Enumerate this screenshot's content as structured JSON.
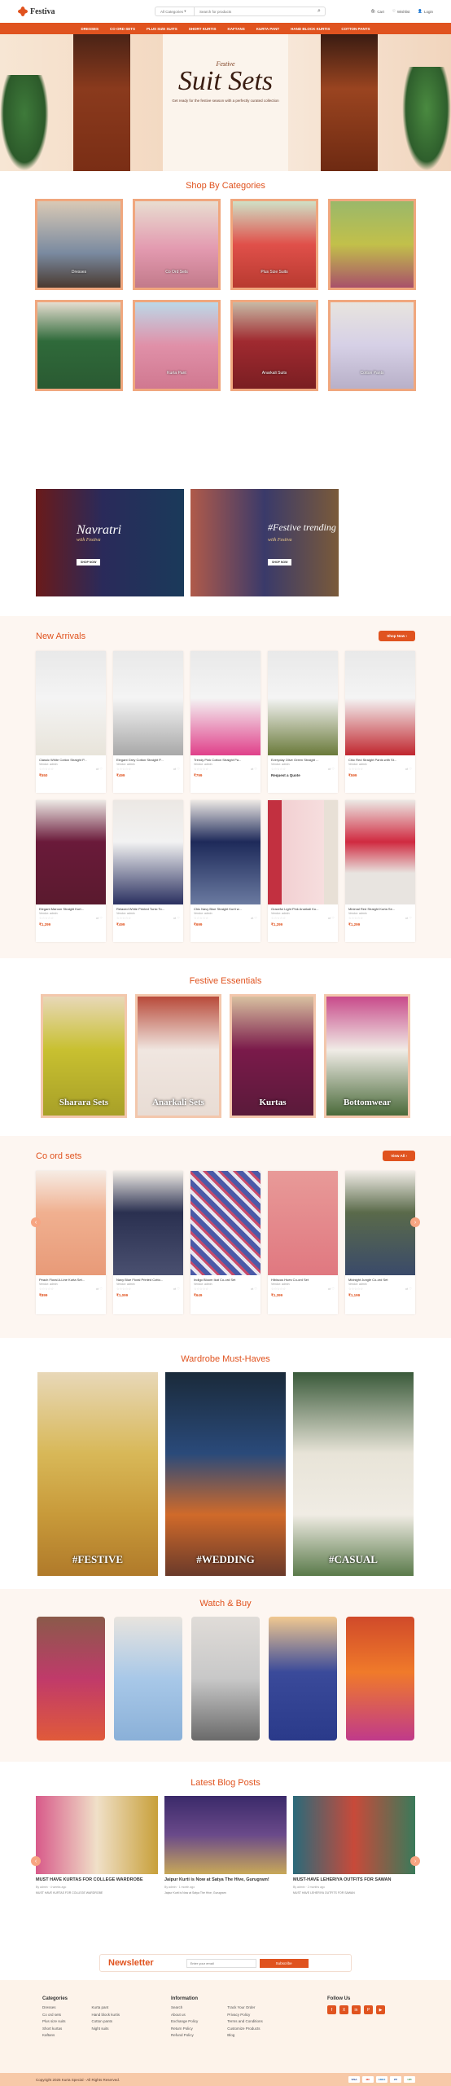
{
  "header": {
    "brand": "Festiva",
    "search_category": "All Categories",
    "search_placeholder": "Search for products",
    "cart_label": "Cart",
    "wishlist_label": "Wishlist",
    "login_label": "Login"
  },
  "nav": [
    "DRESSES",
    "CO ORD SETS",
    "PLUS SIZE SUITS",
    "SHORT KURTIS",
    "KAFTANS",
    "KURTA PANT",
    "HAND BLOCK KURTIS",
    "COTTON PANTS"
  ],
  "hero": {
    "small": "Festive",
    "title": "Suit Sets",
    "subtitle": "Get ready for the festive season with a perfectly curated collection"
  },
  "categories": {
    "title": "Shop By Categories",
    "items": [
      "Dresses",
      "Co Ord Sets",
      "Plus Size Suits",
      "",
      "",
      "Kurta Pant",
      "Anarkali Suits",
      "Cotton Pants"
    ]
  },
  "promos": [
    {
      "title": "Navratri",
      "sub": "with Festiva",
      "button": "SHOP NOW"
    },
    {
      "title": "#Festive trending",
      "sub": "with Festiva",
      "button": "SHOP NOW"
    }
  ],
  "new_arrivals": {
    "title": "New Arrivals",
    "button": "Shop Now",
    "products": [
      {
        "name": "Classic White Cotton Straight P...",
        "vendor": "Vendor: admin",
        "price": "₹550"
      },
      {
        "name": "Elegant Grey Cotton Straight P...",
        "vendor": "Vendor: admin",
        "price": "₹499"
      },
      {
        "name": "Trendy Pink Cotton Straight Pa...",
        "vendor": "Vendor: admin",
        "price": "₹799"
      },
      {
        "name": "Everyday Olive Green Straight ...",
        "vendor": "Vendor: admin",
        "price": "Request a Quote"
      },
      {
        "name": "Chic Red Straight Pants with St...",
        "vendor": "Vendor: admin",
        "price": "₹599"
      },
      {
        "name": "Elegant Maroon Straight Kurt...",
        "vendor": "Vendor: admin",
        "price": "₹1,299"
      },
      {
        "name": "Relaxed White Printed Tunic To...",
        "vendor": "Vendor: admin",
        "price": "₹499"
      },
      {
        "name": "Chic Navy Blue Straight Kurti w...",
        "vendor": "Vendor: admin",
        "price": "₹699"
      },
      {
        "name": "Graceful Light Pink Anarkali Ku...",
        "vendor": "Vendor: admin",
        "price": "₹1,299"
      },
      {
        "name": "Minimal Red Straight Kurta Se...",
        "vendor": "Vendor: admin",
        "price": "₹1,299"
      }
    ]
  },
  "essentials": {
    "title": "Festive Essentials",
    "items": [
      "Sharara Sets",
      "Anarkali Sets",
      "Kurtas",
      "Bottomwear"
    ]
  },
  "coord": {
    "title": "Co ord sets",
    "button": "View All",
    "products": [
      {
        "name": "Peach Floral A-Line Kurta Set...",
        "vendor": "Vendor: admin",
        "price": "₹899"
      },
      {
        "name": "Navy Blue Floral Printed Cotto...",
        "vendor": "Vendor: admin",
        "price": "₹1,099"
      },
      {
        "name": "Indigo Bloom Ikat Co-ord Set",
        "vendor": "Vendor: admin",
        "price": "₹649"
      },
      {
        "name": "Hibiscus Hues Co-ord Set",
        "vendor": "Vendor: admin",
        "price": "₹1,399"
      },
      {
        "name": "Midnight Jungle Co-ord Set",
        "vendor": "Vendor: admin",
        "price": "₹1,199"
      }
    ]
  },
  "wardrobe": {
    "title": "Wardrobe Must-Haves",
    "items": [
      "#FESTIVE",
      "#WEDDING",
      "#CASUAL"
    ]
  },
  "watch": {
    "title": "Watch & Buy"
  },
  "blog": {
    "title": "Latest Blog Posts",
    "posts": [
      {
        "title": "MUST HAVE KURTAS FOR COLLEGE WARDROBE",
        "meta": "By admin · 4 weeks ago",
        "excerpt": "MUST HAVE KURTAS FOR COLLEGE WARDROBE"
      },
      {
        "title": "Jaipur Kurti is Now at Satya The Hive, Gurugram!",
        "meta": "By admin · 1 month ago",
        "excerpt": "Jaipur Kurti is Now at Satya The Hive, Gurugram"
      },
      {
        "title": "MUST-HAVE LEHERIYA OUTFITS FOR SAWAN",
        "meta": "By admin · 2 months ago",
        "excerpt": "MUST HAVE LEHERIYA OUTFITS FOR SAWAN"
      }
    ]
  },
  "newsletter": {
    "title": "Newsletter",
    "placeholder": "Enter your email",
    "button": "Subscribe"
  },
  "footer": {
    "categories_head": "Categories",
    "categories_col1": [
      "Dresses",
      "Co ord sets",
      "Plus size suits",
      "Short kurtas",
      "Kaftans"
    ],
    "categories_col2": [
      "Kurta pant",
      "Hand block kurtis",
      "Cotton pants",
      "Night suits"
    ],
    "info_head": "Information",
    "info_col1": [
      "Search",
      "About us",
      "Exchange Policy",
      "Return Policy",
      "Refund Policy"
    ],
    "info_col2": [
      "Track Your Order",
      "Privacy Policy",
      "Terms and Conditions",
      "Customize Products",
      "Blog"
    ],
    "follow_head": "Follow Us",
    "social": [
      "f",
      "X",
      "in",
      "P",
      "▶"
    ],
    "copyright": "Copyright 2025 Kurta Special - All Rights Reserved.",
    "payments": [
      "VISA",
      "MC",
      "AMEX",
      "PP",
      "UPI"
    ]
  },
  "colors": {
    "accent": "#e0531f",
    "soft_bg": "#fdf6f1"
  }
}
